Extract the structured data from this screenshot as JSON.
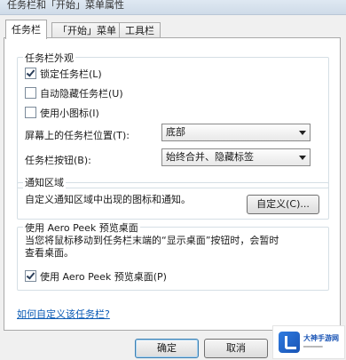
{
  "window": {
    "title": "任务栏和「开始」菜单属性"
  },
  "tabs": [
    {
      "label": "任务栏",
      "active": true
    },
    {
      "label": "「开始」菜单",
      "active": false
    },
    {
      "label": "工具栏",
      "active": false
    }
  ],
  "appearance": {
    "legend": "任务栏外观",
    "lock_taskbar": {
      "label": "锁定任务栏(L)",
      "checked": true
    },
    "autohide": {
      "label": "自动隐藏任务栏(U)",
      "checked": false
    },
    "small_icons": {
      "label": "使用小图标(I)",
      "checked": false
    },
    "position_label": "屏幕上的任务栏位置(T):",
    "position_value": "底部",
    "buttons_label": "任务栏按钮(B):",
    "buttons_value": "始终合并、隐藏标签"
  },
  "notification": {
    "legend": "通知区域",
    "description": "自定义通知区域中出现的图标和通知。",
    "customize_button": "自定义(C)..."
  },
  "aero_peek": {
    "legend": "使用 Aero Peek 预览桌面",
    "description_line1": "当您将鼠标移动到任务栏末端的“显示桌面”按钮时，会暂时",
    "description_line2": "查看桌面。",
    "checkbox": {
      "label": "使用 Aero Peek 预览桌面(P)",
      "checked": true
    }
  },
  "help_link": "如何自定义该任务栏?",
  "footer": {
    "ok_label": "确定",
    "cancel_label": "取消"
  },
  "watermark": {
    "name": "大神手游网"
  }
}
